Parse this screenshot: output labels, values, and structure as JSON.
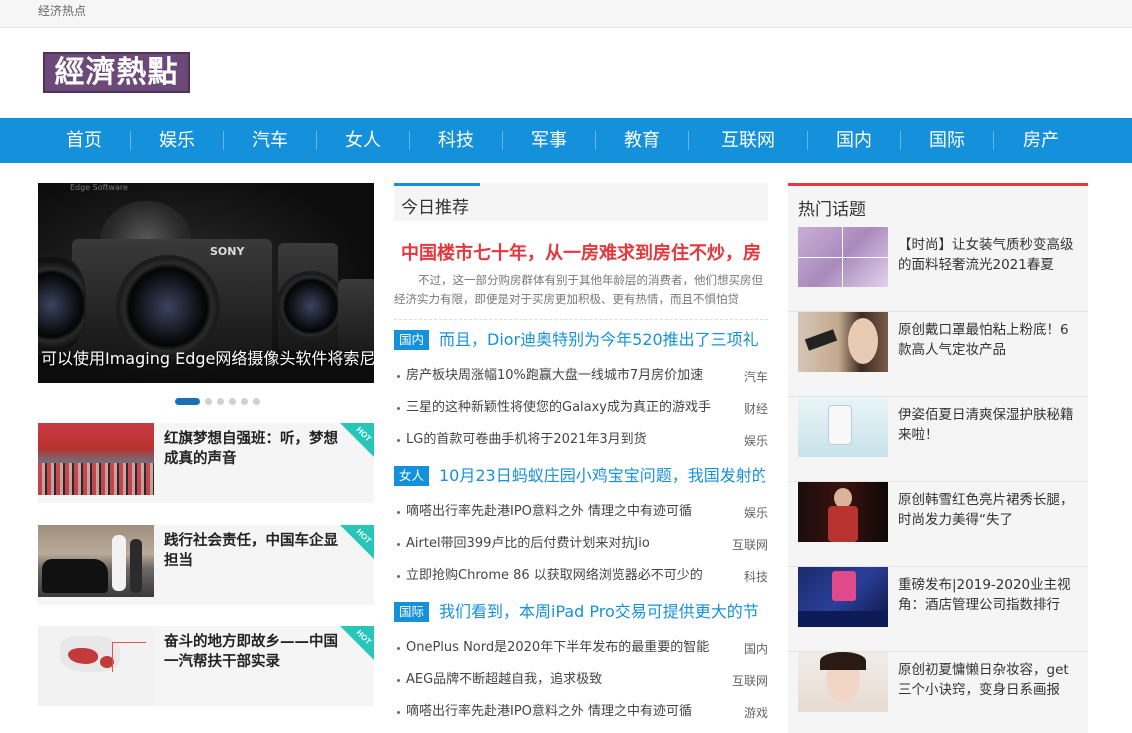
{
  "topbar": {
    "text": "经济热点"
  },
  "logo": {
    "text": "經濟熱點"
  },
  "nav": {
    "items": [
      {
        "label": "首页"
      },
      {
        "label": "娱乐"
      },
      {
        "label": "汽车"
      },
      {
        "label": "女人"
      },
      {
        "label": "科技"
      },
      {
        "label": "军事"
      },
      {
        "label": "教育"
      },
      {
        "label": "互联网"
      },
      {
        "label": "国内"
      },
      {
        "label": "国际"
      },
      {
        "label": "房产"
      }
    ]
  },
  "slider": {
    "caption": "可以使用Imaging Edge网络摄像头软件将索尼",
    "watermark": "Edge Software",
    "brand": "SONY",
    "dots": 6,
    "active_dot": 0
  },
  "hot_cards": [
    {
      "title": "红旗梦想自强班：听，梦想成真的声音",
      "tag": "HOT"
    },
    {
      "title": "践行社会责任，中国车企显担当",
      "tag": "HOT"
    },
    {
      "title": "奋斗的地方即故乡——中国一汽帮扶干部实录",
      "tag": "HOT"
    }
  ],
  "today": {
    "heading": "今日推荐",
    "featured_title": "中国楼市七十年，从一房难求到房住不炒，房",
    "featured_desc": "不过，这一部分购房群体有别于其他年龄层的消费者，他们想买房但经济实力有限，即便是对于买房更加积极、更有热情，而且不惧怕贷",
    "sections": [
      {
        "tag": "国内",
        "title": "而且，Dior迪奥特别为今年520推出了三项礼",
        "items": [
          {
            "text": "房产板块周涨幅10%跑赢大盘一线城市7月房价加速",
            "cat": "汽车"
          },
          {
            "text": "三星的这种新颖性将使您的Galaxy成为真正的游戏手",
            "cat": "财经"
          },
          {
            "text": "LG的首款可卷曲手机将于2021年3月到货",
            "cat": "娱乐"
          }
        ]
      },
      {
        "tag": "女人",
        "title": "10月23日蚂蚁庄园小鸡宝宝问题，我国发射的",
        "items": [
          {
            "text": "嘀嗒出行率先赴港IPO意料之外 情理之中有迹可循",
            "cat": "娱乐"
          },
          {
            "text": "Airtel带回399卢比的后付费计划来对抗Jio",
            "cat": "互联网"
          },
          {
            "text": "立即抢购Chrome 86 以获取网络浏览器必不可少的",
            "cat": "科技"
          }
        ]
      },
      {
        "tag": "国际",
        "title": "我们看到，本周iPad Pro交易可提供更大的节",
        "items": [
          {
            "text": "OnePlus Nord是2020年下半年发布的最重要的智能",
            "cat": "国内"
          },
          {
            "text": "AEG品牌不断超越自我，追求极致",
            "cat": "互联网"
          },
          {
            "text": "嘀嗒出行率先赴港IPO意料之外 情理之中有迹可循",
            "cat": "游戏"
          }
        ]
      }
    ]
  },
  "hot_topics": {
    "heading": "热门话题",
    "items": [
      {
        "text": "【时尚】让女装气质秒变高级的面料轻奢流光2021春夏"
      },
      {
        "text": "原创戴口罩最怕粘上粉底！6款高人气定妆产品"
      },
      {
        "text": "伊姿佰夏日清爽保湿护肤秘籍来啦！"
      },
      {
        "text": "原创韩雪红色亮片裙秀长腿，时尚发力美得“失了"
      },
      {
        "text": "重磅发布|2019-2020业主视角：酒店管理公司指数排行"
      },
      {
        "text": "原创初夏慵懒日杂妆容，get三个小诀窍，变身日系画报"
      }
    ]
  },
  "colors": {
    "nav": "#1591db",
    "accent_red": "#e5373c",
    "hot_tag": "#27c6b8"
  }
}
